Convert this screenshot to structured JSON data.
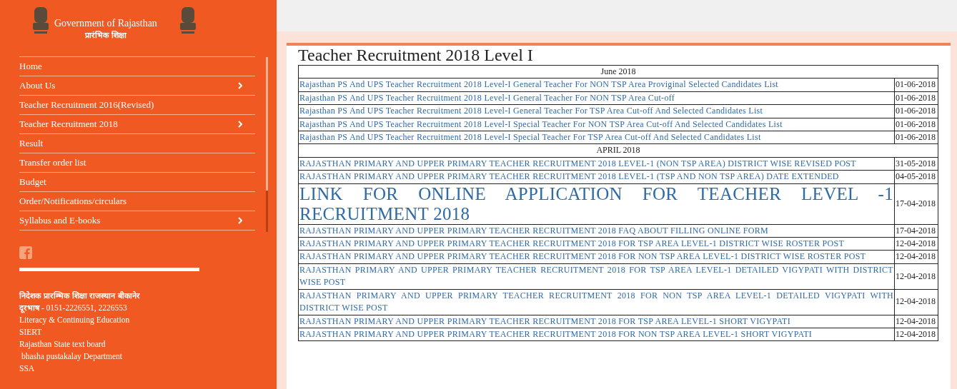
{
  "sidebar": {
    "brand": {
      "title": "Government of Rajasthan",
      "subtitle": "प्रारंभिक शिक्षा"
    },
    "menu": [
      {
        "label": "Home",
        "has_submenu": false
      },
      {
        "label": "About Us",
        "has_submenu": true
      },
      {
        "label": "Teacher Recruitment 2016(Revised)",
        "has_submenu": false
      },
      {
        "label": "Teacher Recruitment 2018",
        "has_submenu": true
      },
      {
        "label": "Result",
        "has_submenu": false
      },
      {
        "label": "Transfer order list",
        "has_submenu": false
      },
      {
        "label": "Budget",
        "has_submenu": false
      },
      {
        "label": "Order/Notifications/circulars",
        "has_submenu": false
      },
      {
        "label": "Syllabus and E-books",
        "has_submenu": true
      }
    ],
    "footer": {
      "office": "निदेशक प्रारम्भिक शिक्षा राजस्थान बीकानेर",
      "phone_label": "दूरभाष",
      "phone": " - 0151-2226551, 2226553",
      "links": [
        "Literacy & Continuing Education",
        "SIERT",
        "Rajasthan State text board",
        " bhasha pustakalay Department",
        "SSA"
      ]
    }
  },
  "content": {
    "title": "Teacher Recruitment 2018 Level I",
    "rows": [
      {
        "kind": "heading",
        "text": "June 2018"
      },
      {
        "kind": "link",
        "text": "Rajasthan PS And UPS Teacher Recruitment 2018 Level-I General Teacher For NON TSP Area Proviginal Selected Candidates List",
        "date": "01-06-2018"
      },
      {
        "kind": "link",
        "text": "Rajasthan PS And UPS Teacher Recruitment 2018 Level-I General Teacher For NON TSP Area Cut-off",
        "date": "01-06-2018"
      },
      {
        "kind": "link",
        "text": "Rajasthan PS And UPS Teacher Recruitment 2018 Level-I General Teacher For TSP Area Cut-off And Selected Candidates List",
        "date": "01-06-2018"
      },
      {
        "kind": "link",
        "text": "Rajasthan PS And UPS Teacher Recruitment 2018 Level-I Special Teacher For NON  TSP Area Cut-off And Selected Candidates List",
        "date": "01-06-2018"
      },
      {
        "kind": "link",
        "text": "Rajasthan PS And UPS Teacher Recruitment 2018 Level-I Special Teacher For TSP Area Cut-off And Selected Candidates List",
        "date": "01-06-2018"
      },
      {
        "kind": "heading",
        "text": "APRIL 2018"
      },
      {
        "kind": "link",
        "text": "RAJASTHAN PRIMARY AND UPPER PRIMARY TEACHER RECRUITMENT 2018 LEVEL-1 (NON TSP AREA) DISTRICT WISE REVISED POST",
        "date": "31-05-2018"
      },
      {
        "kind": "link",
        "text": "RAJASTHAN PRIMARY AND UPPER PRIMARY TEACHER RECRUITMENT 2018 LEVEL-1 (TSP AND NON TSP AREA) DATE EXTENDED",
        "date": "04-05-2018"
      },
      {
        "kind": "big-link",
        "text": "LINK FOR ONLINE APPLICATION FOR TEACHER LEVEL -1 RECRUITMENT 2018",
        "date": "17-04-2018"
      },
      {
        "kind": "link",
        "text": "RAJASTHAN PRIMARY AND UPPER PRIMARY TEACHER RECRUITMENT 2018 FAQ ABOUT FILLING ONLINE FORM",
        "date": "17-04-2018"
      },
      {
        "kind": "link",
        "text": "RAJASTHAN PRIMARY AND UPPER PRIMARY TEACHER RECRUITMENT 2018 FOR TSP AREA LEVEL-1 DISTRICT WISE ROSTER POST",
        "date": "12-04-2018"
      },
      {
        "kind": "link",
        "text": "RAJASTHAN PRIMARY AND UPPER PRIMARY TEACHER RECRUITMENT 2018 FOR NON TSP AREA LEVEL-1 DISTRICT WISE ROSTER POST",
        "date": "12-04-2018"
      },
      {
        "kind": "link",
        "text": "RAJASTHAN PRIMARY AND UPPER PRIMARY TEACHER RECRUITMENT 2018 FOR TSP AREA LEVEL-1 DETAILED VIGYPATI WITH DISTRICT WISE POST",
        "date": "12-04-2018"
      },
      {
        "kind": "link",
        "text": "RAJASTHAN PRIMARY AND UPPER PRIMARY TEACHER RECRUITMENT 2018 FOR NON TSP AREA LEVEL-1 DETAILED VIGYPATI WITH DISTRICT WISE POST",
        "date": "12-04-2018"
      },
      {
        "kind": "link",
        "text": "RAJASTHAN PRIMARY AND UPPER PRIMARY TEACHER RECRUITMENT 2018 FOR TSP AREA LEVEL-1 SHORT VIGYPATI",
        "date": "12-04-2018"
      },
      {
        "kind": "link",
        "text": "RAJASTHAN PRIMARY AND UPPER PRIMARY TEACHER RECRUITMENT 2018 FOR NON TSP AREA LEVEL-1 SHORT VIGYPATI",
        "date": "12-04-2018"
      }
    ]
  }
}
